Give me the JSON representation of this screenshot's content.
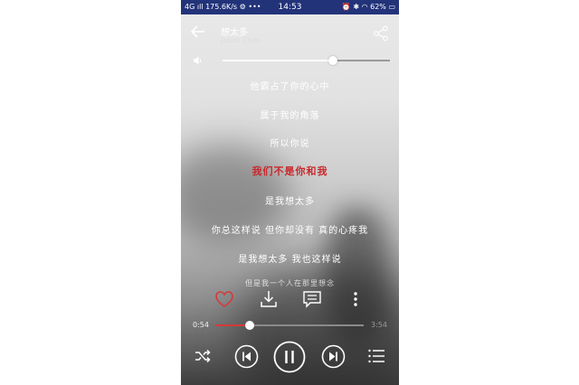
{
  "status_bar": {
    "network": "4G",
    "speed": "175.6K/s",
    "time": "14:53",
    "battery": "62%"
  },
  "header": {
    "song_title": "想太多",
    "artist": "Jason Chen",
    "back_icon": "arrow-left-icon",
    "share_icon": "share-icon"
  },
  "volume": {
    "icon": "speaker-icon",
    "level": 0.66
  },
  "lyrics": {
    "lines": [
      "他霸占了你的心中",
      "属于我的角落",
      "所以你说",
      "我们不是你和我",
      "是我想太多",
      "你总这样说 但你却没有 真的心疼我",
      "是我想太多 我也这样说",
      "但是我一个人在那里想念"
    ],
    "active_index": 3
  },
  "actions": {
    "icons": [
      "heart-icon",
      "download-icon",
      "comment-icon",
      "more-vertical-icon"
    ]
  },
  "progress": {
    "elapsed": "0:54",
    "total": "3:54",
    "fraction": 0.23
  },
  "controls": {
    "icons": [
      "shuffle-icon",
      "previous-icon",
      "pause-icon",
      "next-icon",
      "playlist-icon"
    ]
  },
  "colors": {
    "accent": "#d6393a",
    "status_bar": "#23337a"
  }
}
